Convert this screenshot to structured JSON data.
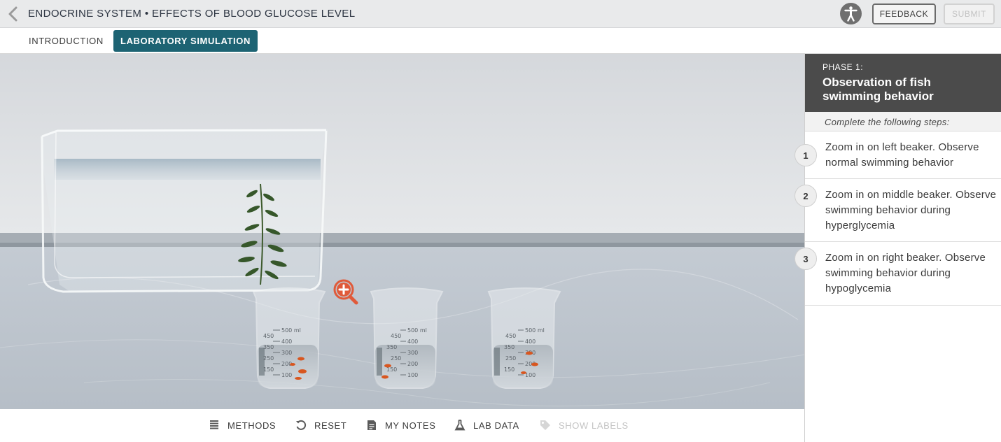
{
  "header": {
    "title": "ENDOCRINE SYSTEM • EFFECTS OF BLOOD GLUCOSE LEVEL",
    "feedback_label": "FEEDBACK",
    "submit_label": "SUBMIT"
  },
  "tabs": [
    {
      "label": "INTRODUCTION",
      "active": false
    },
    {
      "label": "LABORATORY SIMULATION",
      "active": true
    }
  ],
  "scene": {
    "beaker_graduations": [
      "500 ml",
      "450",
      "400",
      "350",
      "300",
      "250",
      "200",
      "150",
      "100"
    ],
    "zoom_icon": "zoom-in-icon"
  },
  "toolbar": {
    "methods_label": "METHODS",
    "reset_label": "RESET",
    "notes_label": "MY NOTES",
    "labdata_label": "LAB DATA",
    "labels_label": "SHOW LABELS"
  },
  "panel": {
    "phase_label": "PHASE 1:",
    "phase_title": "Observation of fish swimming behavior",
    "instructions": "Complete the following steps:",
    "steps": [
      {
        "num": "1",
        "text": "Zoom in on left beaker. Observe normal swimming behavior"
      },
      {
        "num": "2",
        "text": "Zoom in on middle beaker. Observe swimming behavior during hyperglycemia"
      },
      {
        "num": "3",
        "text": "Zoom in on right beaker. Observe swimming behavior during hypoglycemia"
      }
    ]
  },
  "colors": {
    "accent": "#1d6373",
    "phase_header": "#4b4b4b",
    "zoom_icon": "#e05a3a",
    "fish": "#d8561f"
  }
}
